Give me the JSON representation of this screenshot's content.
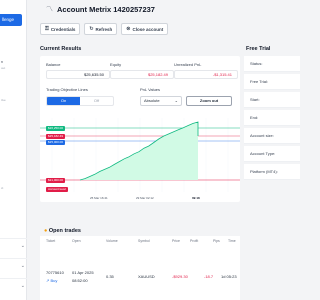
{
  "sidebar": {
    "button_label": "llenge",
    "text1": "n",
    "text2": "out",
    "text3": "tive",
    "text4": "ct"
  },
  "header": {
    "title": "Account Metrix 1420257237"
  },
  "actions": {
    "credentials": "Credentials",
    "refresh": "Refresh",
    "close_account": "Close account"
  },
  "current_results": {
    "title": "Current Results",
    "balance_label": "Balance",
    "balance_value": "$25,635.50",
    "equity_label": "Equity",
    "equity_value": "$25,182.49",
    "upnl_label": "Unrealized PnL",
    "upnl_value": "-$1,315.41",
    "objective_lines_label": "Trading Objective Lines",
    "toggle_on": "On",
    "toggle_off": "Off",
    "pnl_values_label": "PnL Values",
    "pnl_mode": "Absolute",
    "zoom_out": "Zoom out"
  },
  "chart_data": {
    "type": "area",
    "x_labels": [
      "25 Mar 16:41",
      "29 Mar 02:12",
      "09:18"
    ],
    "tags": [
      {
        "label": "$26,250.00",
        "color": "#10b981"
      },
      {
        "label": "$25,182.49",
        "color": "#e11d48"
      },
      {
        "label": "$25,000.00",
        "color": "#1d6ae5"
      },
      {
        "label": "$21,000.00",
        "color": "#e11d48"
      },
      {
        "label": "Account level",
        "color": "#e11d48"
      }
    ],
    "series_points": [
      0,
      2,
      5,
      8,
      12,
      15,
      18,
      22,
      26,
      30,
      33,
      37,
      40,
      45,
      48,
      53,
      58,
      62,
      65,
      68,
      71,
      74,
      77,
      80,
      82
    ]
  },
  "free_trial": {
    "title": "Free Trial",
    "fields": [
      "Status:",
      "Free Trial:",
      "Start:",
      "End:",
      "Account size:",
      "Account Type:",
      "Platform (MT4):"
    ]
  },
  "open_trades": {
    "title": "Open trades",
    "headers": [
      "Ticket",
      "Open",
      "Volume",
      "Symbol",
      "Price",
      "Profit",
      "Pips",
      "Time"
    ],
    "row": {
      "ticket": "70775610",
      "side": "Buy",
      "open_date": "01 Apr 2025",
      "open_time": "08:52:00",
      "volume": "0.35",
      "symbol": "XAUUSD",
      "profit": "-$929.30",
      "pips": "-18.7",
      "time": "1d 05:23"
    }
  }
}
